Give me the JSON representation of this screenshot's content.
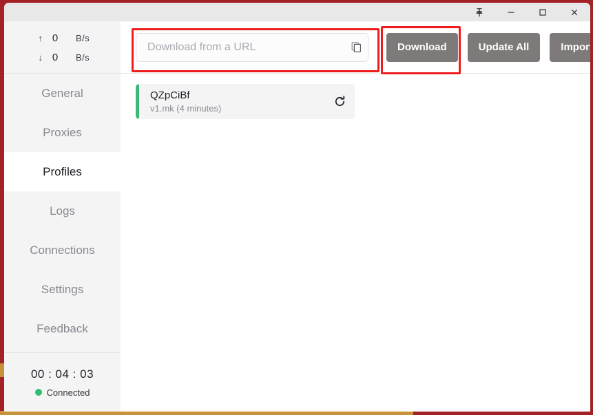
{
  "window": {
    "frame_color": "#a32226",
    "accent_color": "#c8923a",
    "titlebar": {
      "pin_label": "Pin",
      "minimize_label": "Minimize",
      "maximize_label": "Maximize",
      "close_label": "Close"
    }
  },
  "sidebar": {
    "speed": {
      "upload": {
        "arrow": "↑",
        "value": "0",
        "unit": "B/s"
      },
      "download": {
        "arrow": "↓",
        "value": "0",
        "unit": "B/s"
      }
    },
    "items": [
      {
        "label": "General",
        "selected": false
      },
      {
        "label": "Proxies",
        "selected": false
      },
      {
        "label": "Profiles",
        "selected": true
      },
      {
        "label": "Logs",
        "selected": false
      },
      {
        "label": "Connections",
        "selected": false
      },
      {
        "label": "Settings",
        "selected": false
      },
      {
        "label": "Feedback",
        "selected": false
      }
    ],
    "footer": {
      "timer": "00 : 04 : 03",
      "status": "Connected",
      "status_color": "#2cbf6e"
    }
  },
  "toolbar": {
    "url_input": {
      "value": "",
      "placeholder": "Download from a URL"
    },
    "paste_icon": "copy-icon",
    "download_label": "Download",
    "update_all_label": "Update All",
    "import_label": "Import",
    "highlight_color": "#ee1c1c"
  },
  "main": {
    "profiles": [
      {
        "name": "QZpCiBf",
        "detail": "v1.mk (4 minutes)",
        "accent_color": "#3cb878"
      }
    ]
  }
}
